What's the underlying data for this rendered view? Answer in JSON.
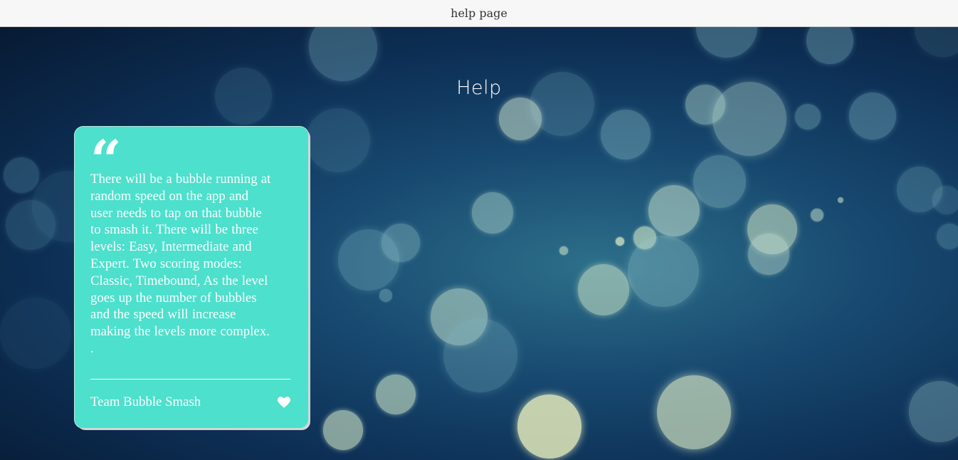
{
  "window": {
    "title": "help page"
  },
  "page": {
    "heading": "Help"
  },
  "card": {
    "quote_glyph": "“",
    "text": "There will be a bubble running at\nrandom speed on the app and\nuser needs to tap on that bubble\nto smash it. There will be three\nlevels: Easy, Intermediate and\nExpert. Two scoring modes:\nClassic, Timebound, As the level\ngoes up the number of bubbles\nand the speed will increase\nmaking the levels more complex.\n.",
    "author": "Team Bubble Smash",
    "icon": "heart-icon"
  },
  "colors": {
    "card_background": "#4de0cc",
    "background_dark": "#0d2f55",
    "titlebar_background": "#f7f7f7"
  }
}
